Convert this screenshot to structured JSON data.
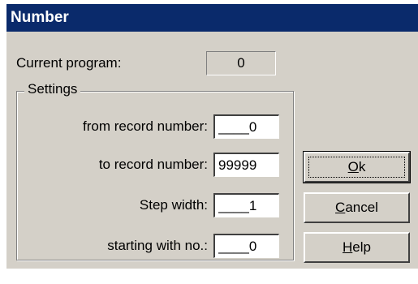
{
  "title": "Number",
  "current_program": {
    "label": "Current program:",
    "value": "0"
  },
  "settings": {
    "group_label": "Settings",
    "fields": [
      {
        "label": "from record number:",
        "value": "____0"
      },
      {
        "label": "to record number:",
        "value": "99999"
      },
      {
        "label": "Step width:",
        "value": "____1"
      },
      {
        "label": "starting with no.:",
        "value": "____0"
      }
    ]
  },
  "buttons": {
    "ok": {
      "mnemonic": "O",
      "rest": "k"
    },
    "cancel": {
      "mnemonic": "C",
      "rest": "ancel"
    },
    "help": {
      "mnemonic": "H",
      "rest": "elp"
    }
  },
  "colors": {
    "titlebar": "#0a2a6b",
    "dialog_face": "#d4d0c8"
  }
}
